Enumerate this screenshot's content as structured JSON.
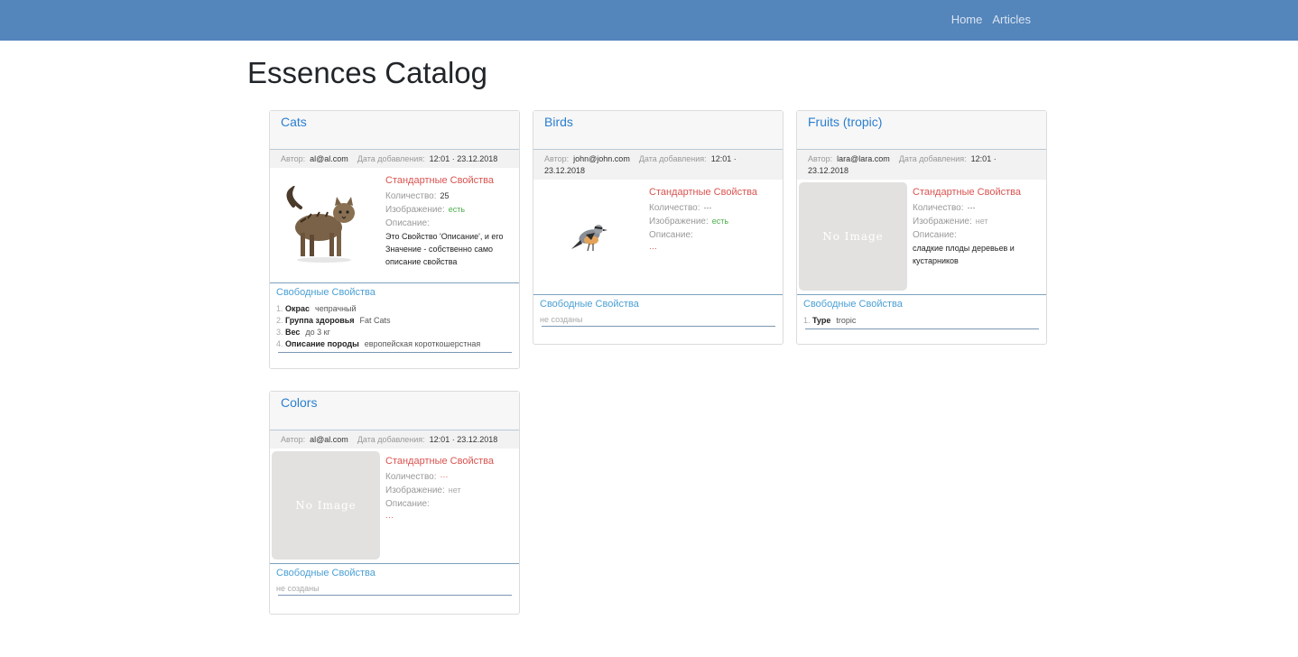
{
  "nav": {
    "home": "Home",
    "articles": "Articles"
  },
  "page": {
    "title": "Essences Catalog"
  },
  "labels": {
    "author": "Автор:",
    "date_added": "Дата добавления:",
    "standard_props": "Стандартные Свойства",
    "quantity": "Количество:",
    "image": "Изображение:",
    "description": "Описание:",
    "free_props": "Свободные Свойства",
    "no_image": "No Image"
  },
  "cards": [
    {
      "title": "Cats",
      "author": "al@al.com",
      "date": "12:01 · 23.12.2018",
      "quantity": "25",
      "image_status": "есть",
      "description": "Это Свойство 'Описание', и его Значение - собственно само описание свойства",
      "free": [
        {
          "key": "Окрас",
          "value": "чепрачный"
        },
        {
          "key": "Группа здоровья",
          "value": "Fat Cats"
        },
        {
          "key": "Вес",
          "value": "до 3 кг"
        },
        {
          "key": "Описание породы",
          "value": "европейская короткошерстная"
        }
      ]
    },
    {
      "title": "Birds",
      "author": "john@john.com",
      "date": "12:01 · 23.12.2018",
      "quantity": "···",
      "image_status": "есть",
      "description": "···",
      "free_empty": "не созданы"
    },
    {
      "title": "Fruits (tropic)",
      "author": "lara@lara.com",
      "date": "12:01 · 23.12.2018",
      "quantity": "···",
      "image_status": "нет",
      "description": "сладкие плоды деревьев и кустарников",
      "free": [
        {
          "key": "Type",
          "value": "tropic"
        }
      ]
    },
    {
      "title": "Colors",
      "author": "al@al.com",
      "date": "12:01 · 23.12.2018",
      "quantity": "···",
      "image_status": "нет",
      "description": "···",
      "free_empty": "не созданы"
    }
  ]
}
